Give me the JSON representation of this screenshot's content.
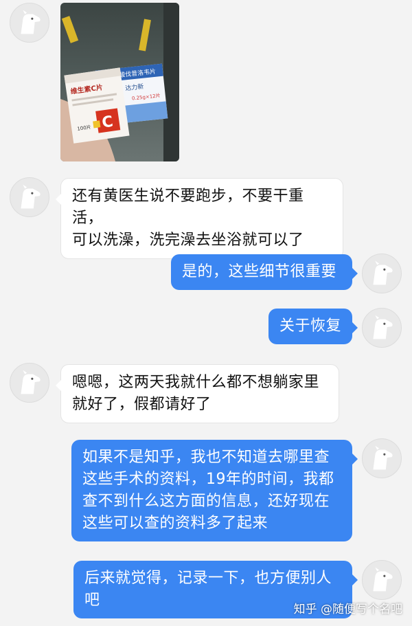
{
  "messages": [
    {
      "side": "left",
      "type": "image",
      "alt": "medicine boxes photo"
    },
    {
      "side": "left",
      "type": "text",
      "lines": [
        "还有黄医生说不要跑步，不要干重活，",
        "可以洗澡，洗完澡去坐浴就可以了"
      ]
    },
    {
      "side": "right",
      "type": "text",
      "lines": [
        "是的，这些细节很重要"
      ]
    },
    {
      "side": "right",
      "type": "text",
      "lines": [
        "关于恢复"
      ]
    },
    {
      "side": "left",
      "type": "text",
      "lines": [
        "嗯嗯，这两天我就什么都不想躺家里",
        "就好了，假都请好了"
      ]
    },
    {
      "side": "right",
      "type": "text",
      "lines": [
        "如果不是知乎，我也不知道去哪里查",
        "这些手术的资料，19年的时间，我都",
        "查不到什么这方面的信息，还好现在",
        "这些可以查的资料多了起来"
      ]
    },
    {
      "side": "right",
      "type": "text",
      "lines": [
        "后来就觉得，记录一下，也方便别人",
        "吧"
      ]
    }
  ],
  "photo": {
    "box1_brand": "维生素C片",
    "box1_count": "100片",
    "box2_title": "盐酸伐昔洛韦片",
    "box2_brand": "达力新",
    "box2_spec": "0.25g×12片"
  },
  "watermark": "知乎 @随便写个名吧",
  "colors": {
    "background": "#f3f3f3",
    "left_bubble": "#ffffff",
    "right_bubble": "#3b86f2"
  }
}
